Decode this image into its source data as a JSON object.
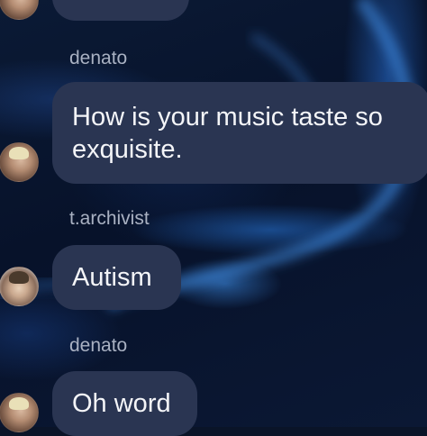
{
  "messages": [
    {
      "sender": "denato",
      "text": "How is your music taste so exquisite."
    },
    {
      "sender": "t.archivist",
      "text": "Autism"
    },
    {
      "sender": "denato",
      "text": "Oh word"
    }
  ]
}
